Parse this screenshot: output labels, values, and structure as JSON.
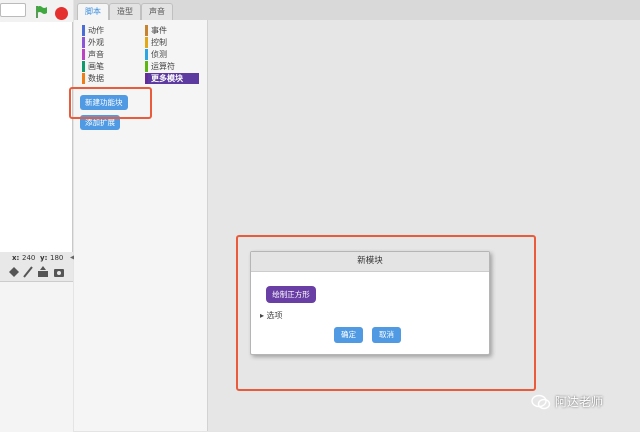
{
  "tabs": [
    {
      "label": "脚本"
    },
    {
      "label": "造型"
    },
    {
      "label": "声音"
    }
  ],
  "categories_left": [
    {
      "label": "动作",
      "color": "#4a6cd4"
    },
    {
      "label": "外观",
      "color": "#8a55d7"
    },
    {
      "label": "声音",
      "color": "#bb42c3"
    },
    {
      "label": "画笔",
      "color": "#0e9a6c"
    },
    {
      "label": "数据",
      "color": "#ee7d16"
    }
  ],
  "categories_right": [
    {
      "label": "事件",
      "color": "#c88330"
    },
    {
      "label": "控制",
      "color": "#e1a91a"
    },
    {
      "label": "侦测",
      "color": "#2ca5e2"
    },
    {
      "label": "运算符",
      "color": "#5cb712"
    },
    {
      "label": "更多模块",
      "color": "#632d99"
    }
  ],
  "palette": {
    "make_block": "新建功能块",
    "add_extension": "添加扩展"
  },
  "stage": {
    "x_label": "x:",
    "x_value": "240",
    "y_label": "y:",
    "y_value": "180"
  },
  "dialog": {
    "title": "新模块",
    "block_label": "绘制正方形",
    "options": "▸ 选项",
    "ok": "确定",
    "cancel": "取消"
  },
  "watermark": {
    "text": "阿达老师"
  },
  "colors": {
    "accent": "#4f9ae3",
    "highlight": "#ea5b3c",
    "more_blocks": "#632d99"
  }
}
